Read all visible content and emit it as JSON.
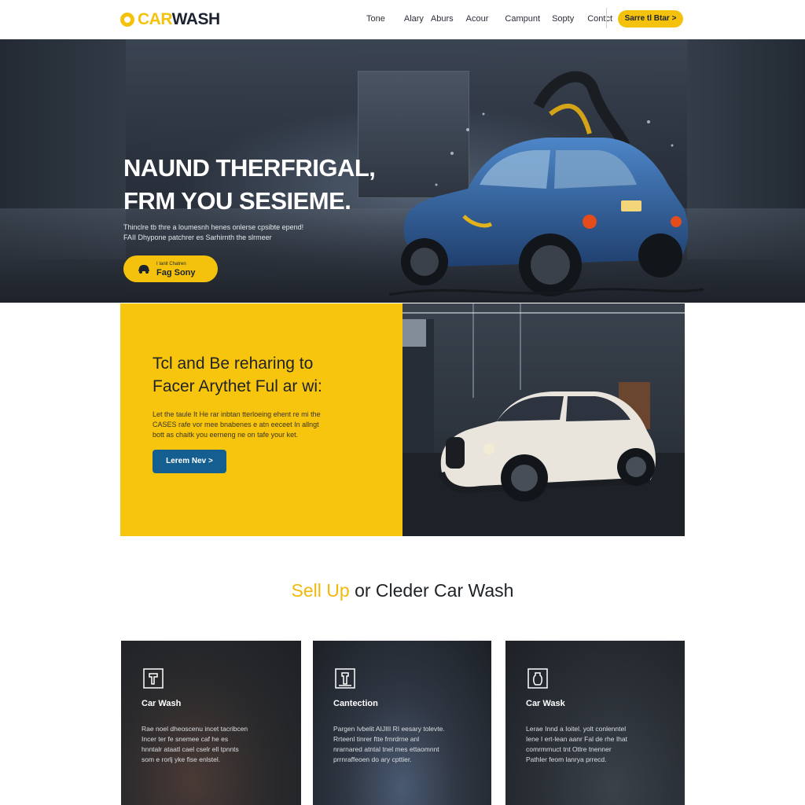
{
  "brand": {
    "logo_main": "CAR",
    "logo_accent": "WASH",
    "accent_color": "#f4c20d"
  },
  "nav": {
    "items": [
      "Tone",
      "Alary",
      "Aburs",
      "Acour",
      "Campunt",
      "Sopty",
      "Contct"
    ]
  },
  "header_cta": {
    "label": "Sarre tl Btar >"
  },
  "hero": {
    "title_lines": [
      "NAUND THERFRIGAL,",
      "FRM YOU SESIEME."
    ],
    "subtitle_lines": [
      "Thinclre tb thre a loumesnh henes onlerse cpsibte epend!",
      "FAII Dhypone patchrer es Sarhirnth the slrmeer"
    ],
    "button_small": "I Ianit Chatren",
    "button_label": "Fag Sony"
  },
  "feature": {
    "title_lines": [
      "Tcl and Be reharing to",
      "Facer Arythet Ful ar wi:"
    ],
    "body_lines": [
      "Let the taule It He rar inbtan tterloeing ehent re mi the",
      "CASES rafe vor mee bnabenes e atn eeceet In allngt",
      "bott as chaitk you eerneng ne on tafe your ket."
    ],
    "button_label": "Lerem Nev >"
  },
  "section": {
    "title_accent": "Sell Up",
    "title_rest": " or Cleder Car Wash"
  },
  "cards": [
    {
      "icon": "brush-tool-icon",
      "title": "Car Wash",
      "body_lines": [
        "Rae noel dheoscenu incet tacribcen",
        "Incer ter fe snemee caf he es",
        "hnntalr ataatl cael cselr ell tpnnts",
        "som e rorlj yke fise enlstel."
      ]
    },
    {
      "icon": "spray-nozzle-icon",
      "title": "Cantection",
      "body_lines": [
        "Pargen Ivbelit AIJIII RI eesary tolevte.",
        "Rrteenl tinrer ftte frnrdrne anl",
        "nrarnared atntal tnel mes ettaomnnt",
        "prrnraffeoen do ary cpttier."
      ]
    },
    {
      "icon": "spray-bottle-icon",
      "title": "Car Wask",
      "body_lines": [
        "Lerae Innd a Ioitel. yolt conlenntel",
        "Iene I ert-lean aanr Fal de rhe Ihat",
        "comrmrnuct tnt Otlre tnenner",
        "Pathler feom lanrya prrecd."
      ]
    }
  ]
}
